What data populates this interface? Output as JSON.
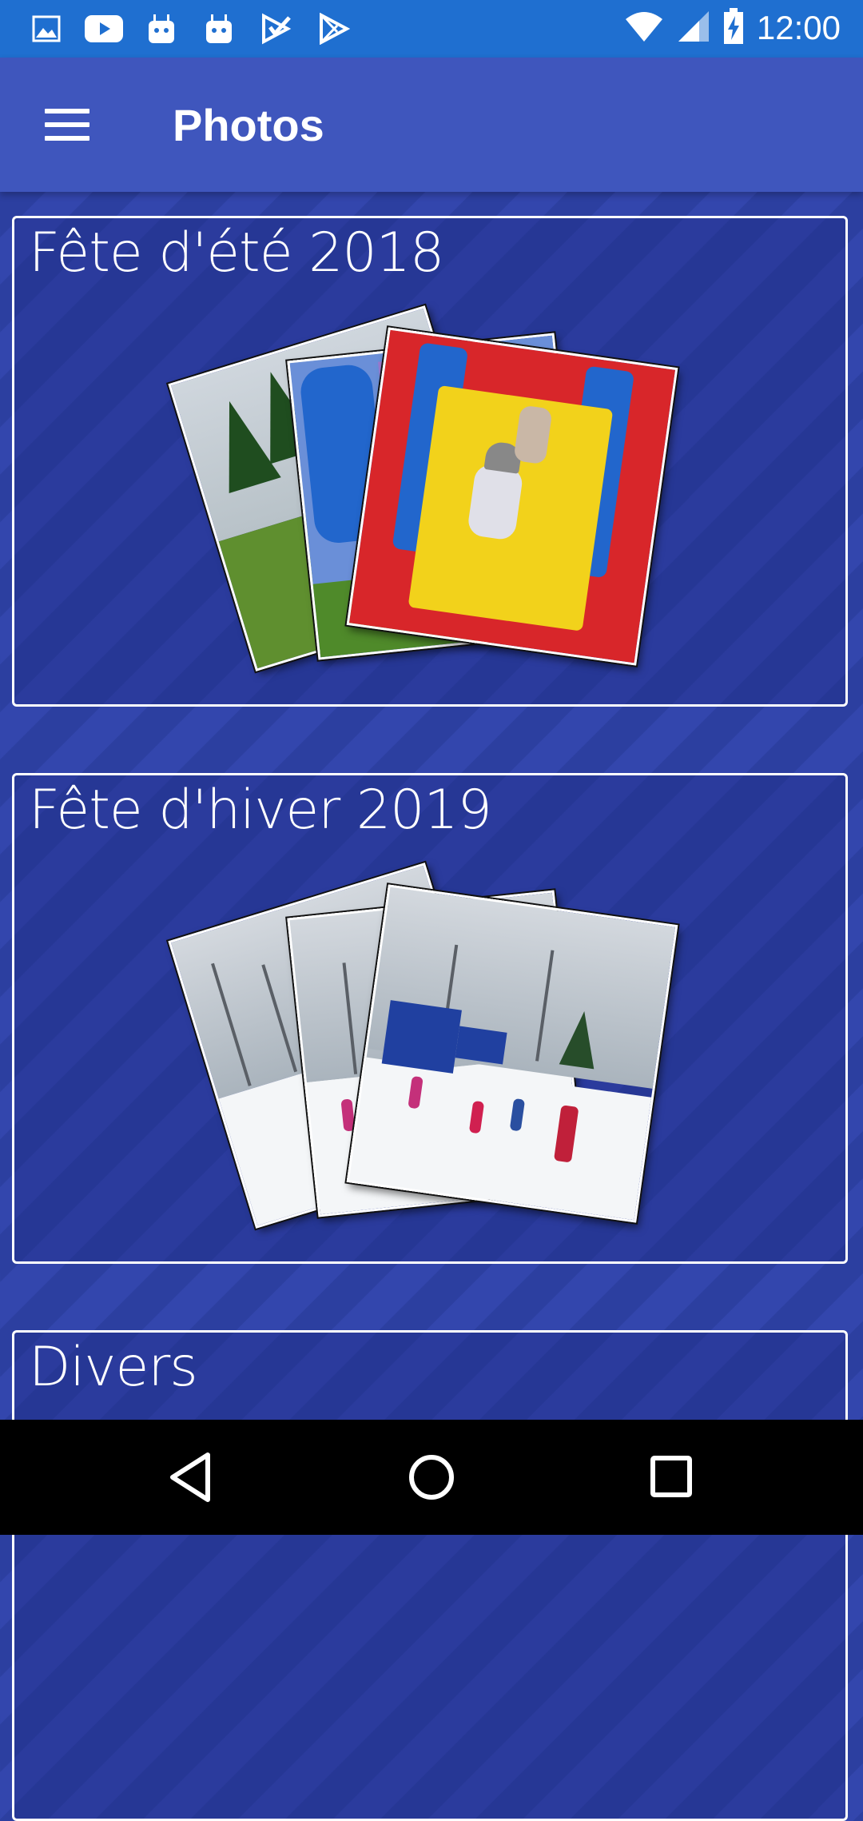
{
  "status_bar": {
    "time": "12:00",
    "left_icons": [
      "gallery-icon",
      "youtube-icon",
      "android-icon",
      "android-icon",
      "check-play-icon",
      "play-store-icon"
    ],
    "right_icons": [
      "wifi-icon",
      "signal-icon",
      "battery-charging-icon"
    ]
  },
  "app_bar": {
    "title": "Photos",
    "menu_icon": "menu-icon"
  },
  "albums": [
    {
      "title": "Fête d'été 2018",
      "photo_count_shown": 3
    },
    {
      "title": "Fête d'hiver 2019",
      "photo_count_shown": 3
    },
    {
      "title": "Divers"
    }
  ],
  "nav_bar": {
    "icons": [
      "back-icon",
      "home-icon",
      "recents-icon"
    ]
  },
  "colors": {
    "status_bar": "#1f6fd0",
    "app_bar": "#3f56bd",
    "background": "#2c3fa0",
    "nav_bar": "#000000"
  }
}
